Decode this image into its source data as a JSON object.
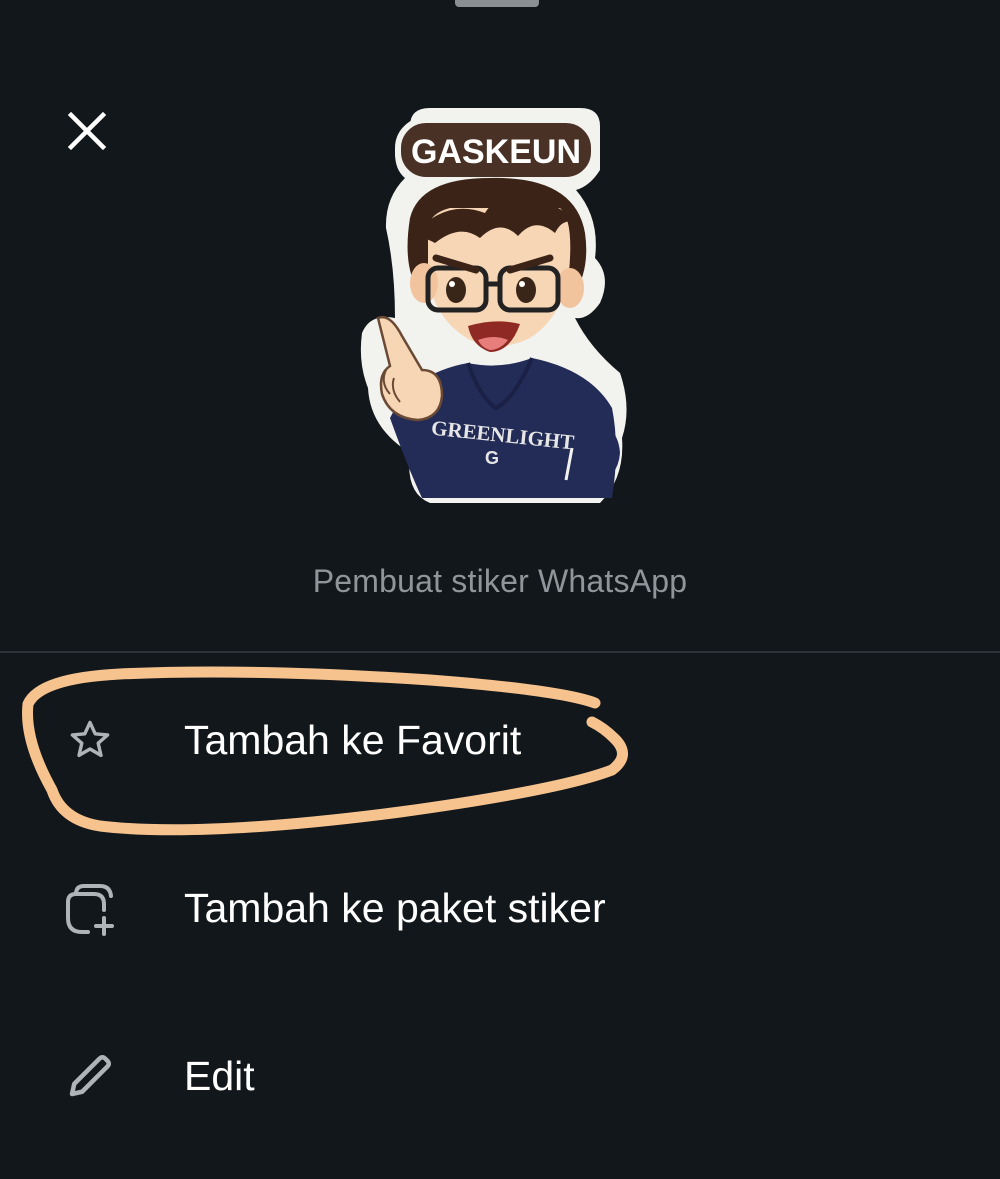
{
  "sheet": {
    "close_icon": "close-icon",
    "sticker": {
      "banner_text": "GASKEUN",
      "shirt_text": "GREENLIGHT",
      "shirt_logo": "G"
    },
    "creator_text": "Pembuat stiker WhatsApp"
  },
  "menu": {
    "items": [
      {
        "label": "Tambah ke Favorit",
        "icon": "star-icon"
      },
      {
        "label": "Tambah ke paket stiker",
        "icon": "sticker-add-icon"
      },
      {
        "label": "Edit",
        "icon": "pencil-icon"
      }
    ]
  },
  "colors": {
    "background": "#12171b",
    "text_primary": "#ffffff",
    "text_secondary": "#8f969b",
    "highlight_stroke": "#f6c28e",
    "icon": "#aeb4b8"
  }
}
